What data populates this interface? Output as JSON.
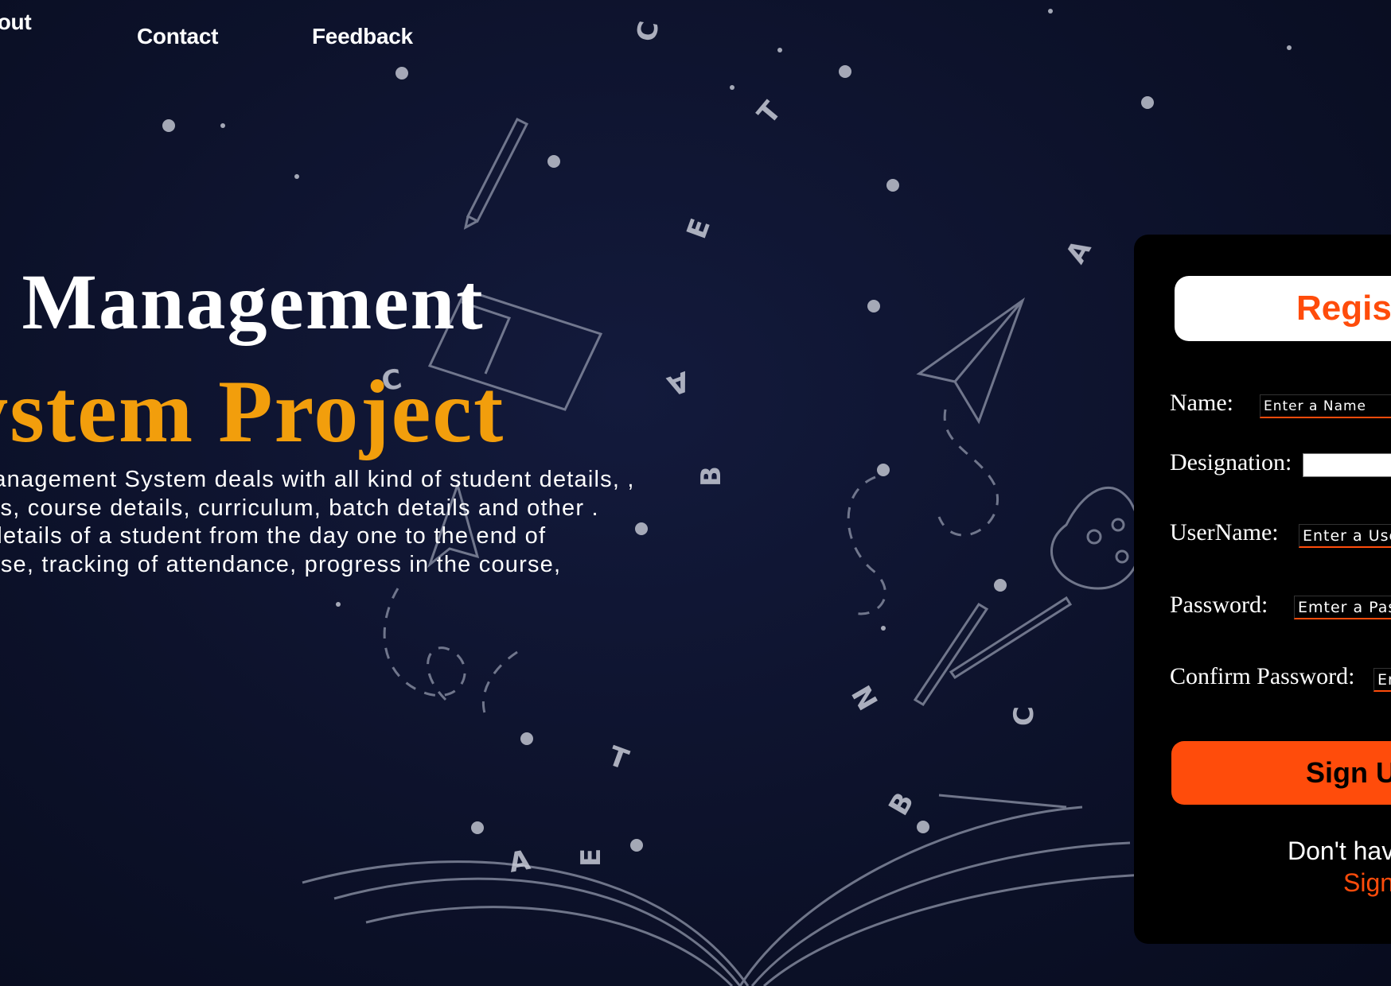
{
  "nav": {
    "items": [
      {
        "label": "About"
      },
      {
        "label": "Contact"
      },
      {
        "label": "Feedback"
      }
    ]
  },
  "hero": {
    "title": "College Management",
    "subtitle": "System Project",
    "description": [
      "College Management System deals with all kind of student details, ,",
      "academic details, course details, curriculum, batch details and other .",
      "It tracks all the details of a student from the day one to the end of",
      "the course purpose, tracking of attendance, progress in the course,"
    ]
  },
  "register": {
    "title": "Register",
    "fields": {
      "name": {
        "label": "Name:",
        "placeholder": "Enter a Name"
      },
      "designation": {
        "label": "Designation:",
        "value": ""
      },
      "username": {
        "label": "UserName:",
        "placeholder": "Enter a UserName"
      },
      "password": {
        "label": "Password:",
        "placeholder": "Emter a Password"
      },
      "confirm_password": {
        "label": "Confirm Password:",
        "placeholder": "Enter Password"
      }
    },
    "signup_label": "Sign Up",
    "note": "Don't have an account?",
    "signin_label": "Sign In"
  },
  "colors": {
    "background": "#0e1430",
    "accent": "#ff4c0b",
    "subtitle": "#f29e0c",
    "card": "#000000"
  },
  "icons": {
    "select_arrow": "chevron-down-icon"
  }
}
